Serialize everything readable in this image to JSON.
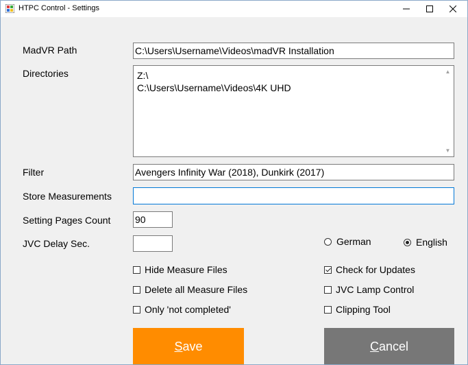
{
  "window": {
    "title": "HTPC Control - Settings"
  },
  "form": {
    "madvr_label": "MadVR Path",
    "madvr_value": "C:\\Users\\Username\\Videos\\madVR Installation",
    "directories_label": "Directories",
    "directories": [
      "Z:\\",
      "C:\\Users\\Username\\Videos\\4K UHD"
    ],
    "filter_label": "Filter",
    "filter_value": "Avengers Infinity War (2018), Dunkirk (2017)",
    "store_label": "Store Measurements",
    "store_value": "",
    "pages_label": "Setting Pages Count",
    "pages_value": "90",
    "jvc_delay_label": "JVC Delay Sec.",
    "jvc_delay_value": ""
  },
  "language": {
    "german_label": "German",
    "english_label": "English",
    "selected": "English"
  },
  "options": {
    "hide_measure": {
      "label": "Hide Measure Files",
      "checked": false
    },
    "delete_measure": {
      "label": "Delete all Measure Files",
      "checked": false
    },
    "only_not_completed": {
      "label": "Only 'not completed'",
      "checked": false
    },
    "check_updates": {
      "label": "Check for Updates",
      "checked": true
    },
    "jvc_lamp": {
      "label": "JVC Lamp Control",
      "checked": false
    },
    "clipping_tool": {
      "label": "Clipping Tool",
      "checked": false
    }
  },
  "buttons": {
    "save_first": "S",
    "save_rest": "ave",
    "cancel_first": "C",
    "cancel_rest": "ancel"
  },
  "colors": {
    "save": "#ff8c00",
    "cancel": "#777777",
    "focus": "#0078d7"
  }
}
